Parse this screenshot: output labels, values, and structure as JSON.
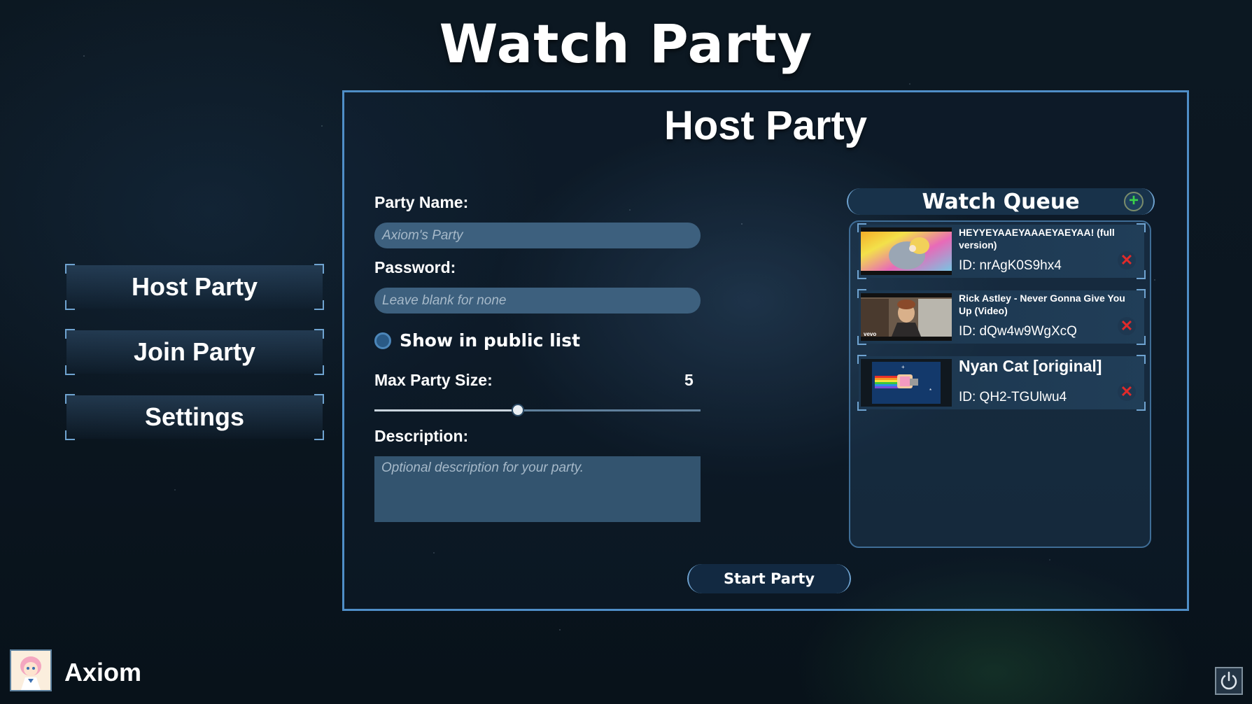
{
  "app": {
    "title": "Watch Party"
  },
  "nav": {
    "items": [
      {
        "label": "Host Party"
      },
      {
        "label": "Join Party"
      },
      {
        "label": "Settings"
      }
    ]
  },
  "host_panel": {
    "title": "Host Party",
    "party_name": {
      "label": "Party Name:",
      "placeholder": "Axiom's Party"
    },
    "password": {
      "label": "Password:",
      "placeholder": "Leave blank for none"
    },
    "public_toggle": {
      "label": "Show in public list",
      "checked": false
    },
    "max_size": {
      "label": "Max Party Size:",
      "value": "5",
      "fraction": 0.44
    },
    "description": {
      "label": "Description:",
      "placeholder": "Optional description for your party."
    },
    "start_button": "Start Party"
  },
  "watch_queue": {
    "title": "Watch Queue",
    "add_icon": "plus-icon",
    "items": [
      {
        "title": "HEYYEYAAEYAAAEYAEYAA! (full version)",
        "id": "ID: nrAgK0S9hx4",
        "thumb_label": "",
        "remove_icon": "close-icon"
      },
      {
        "title": "Rick Astley - Never Gonna Give You Up (Video)",
        "id": "ID: dQw4w9WgXcQ",
        "thumb_label": "vevo",
        "remove_icon": "close-icon"
      },
      {
        "title": "Nyan Cat [original]",
        "id": "ID: QH2-TGUlwu4",
        "thumb_label": "",
        "remove_icon": "close-icon"
      }
    ]
  },
  "user": {
    "name": "Axiom"
  },
  "colors": {
    "accent": "#4f8ec7",
    "add": "#39d14a",
    "remove": "#e12a2a"
  }
}
